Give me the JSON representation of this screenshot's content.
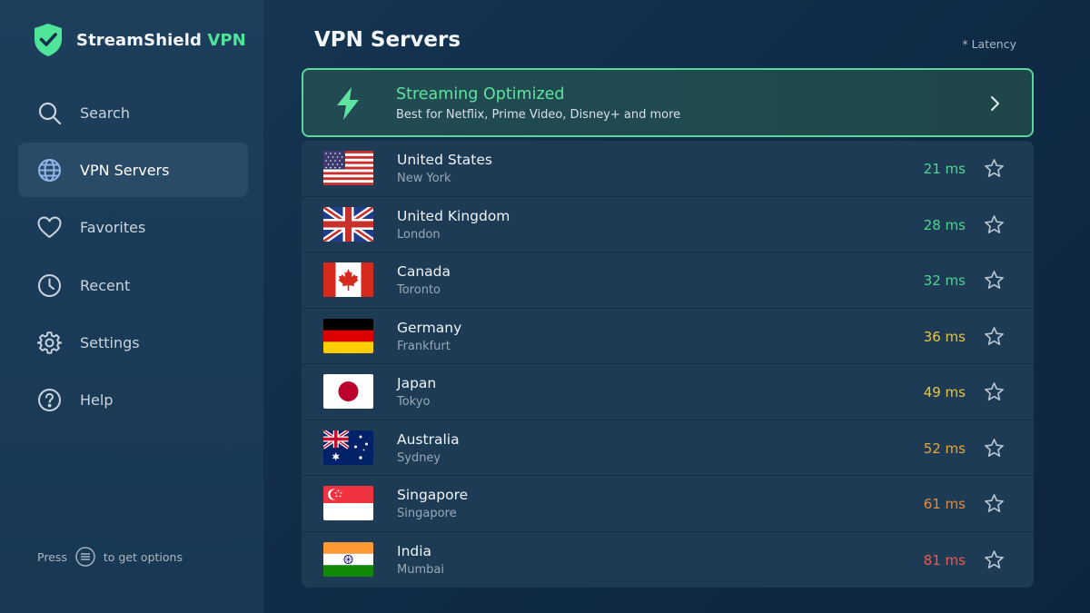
{
  "app": {
    "name": "StreamShield",
    "name_accent": "VPN"
  },
  "sidebar": {
    "items": [
      {
        "label": "Search",
        "icon": "search-icon",
        "active": false
      },
      {
        "label": "VPN Servers",
        "icon": "globe-icon",
        "active": true
      },
      {
        "label": "Favorites",
        "icon": "heart-icon",
        "active": false
      },
      {
        "label": "Recent",
        "icon": "clock-icon",
        "active": false
      },
      {
        "label": "Settings",
        "icon": "gear-icon",
        "active": false
      },
      {
        "label": "Help",
        "icon": "help-icon",
        "active": false
      }
    ],
    "hint": {
      "prefix": "Press",
      "suffix": "to get options",
      "icon": "menu-button-icon"
    }
  },
  "main": {
    "title": "VPN Servers",
    "latency_note": "* Latency",
    "promo": {
      "title": "Streaming Optimized",
      "subtitle": "Best for Netflix, Prime Video, Disney+ and more",
      "icon": "lightning-icon"
    },
    "servers": [
      {
        "country": "United States",
        "city": "New York",
        "latency": "21 ms",
        "latency_color": "#4fd68f",
        "flag": "us"
      },
      {
        "country": "United Kingdom",
        "city": "London",
        "latency": "28 ms",
        "latency_color": "#4fd68f",
        "flag": "uk"
      },
      {
        "country": "Canada",
        "city": "Toronto",
        "latency": "32 ms",
        "latency_color": "#4fd68f",
        "flag": "ca"
      },
      {
        "country": "Germany",
        "city": "Frankfurt",
        "latency": "36 ms",
        "latency_color": "#e6c63c",
        "flag": "de"
      },
      {
        "country": "Japan",
        "city": "Tokyo",
        "latency": "49 ms",
        "latency_color": "#e6c63c",
        "flag": "jp"
      },
      {
        "country": "Australia",
        "city": "Sydney",
        "latency": "52 ms",
        "latency_color": "#eba53a",
        "flag": "au"
      },
      {
        "country": "Singapore",
        "city": "Singapore",
        "latency": "61 ms",
        "latency_color": "#e8893a",
        "flag": "sg"
      },
      {
        "country": "India",
        "city": "Mumbai",
        "latency": "81 ms",
        "latency_color": "#ec5a4f",
        "flag": "in"
      }
    ]
  },
  "colors": {
    "accent": "#4ee59a",
    "sidebar_active": "#2a4b68",
    "promo_border": "#5ad79a"
  }
}
